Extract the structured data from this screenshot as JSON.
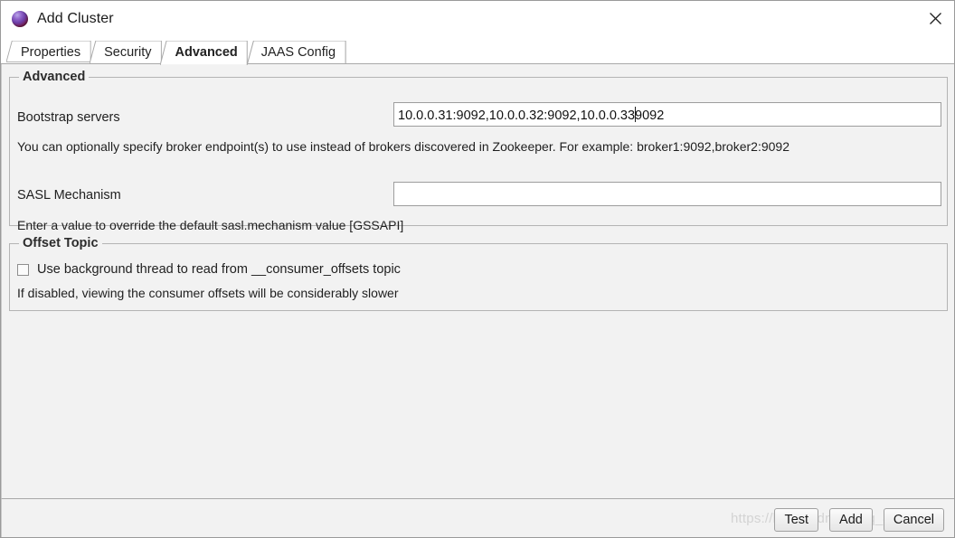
{
  "window": {
    "title": "Add Cluster",
    "icon": "cluster-sphere-icon",
    "close_label": "×"
  },
  "tabs": [
    {
      "label": "Properties",
      "selected": false
    },
    {
      "label": "Security",
      "selected": false
    },
    {
      "label": "Advanced",
      "selected": true
    },
    {
      "label": "JAAS Config",
      "selected": false
    }
  ],
  "advanced_group": {
    "title": "Advanced",
    "bootstrap": {
      "label": "Bootstrap servers",
      "value": "10.0.0.31:9092,10.0.0.32:9092,10.0.0.33:9092",
      "value_before_caret": "10.0.0.31:9092,10.0.0.32:9092,10.0.0.33",
      "value_after_caret": "9092",
      "placeholder": "",
      "help": "You can optionally specify broker endpoint(s) to use instead of brokers discovered in Zookeeper. For example: broker1:9092,broker2:9092"
    },
    "sasl": {
      "label": "SASL Mechanism",
      "value": "",
      "placeholder": "",
      "help": "Enter a value to override the default sasl.mechanism value [GSSAPI]"
    }
  },
  "offset_group": {
    "title": "Offset Topic",
    "checkbox_label": "Use background thread to read from __consumer_offsets topic",
    "checkbox_checked": false,
    "help": "If disabled, viewing the consumer offsets will be considerably slower"
  },
  "footer": {
    "watermark": "https://blog.csdn.net/qq_42",
    "buttons": [
      {
        "label": "Test"
      },
      {
        "label": "Add"
      },
      {
        "label": "Cancel"
      }
    ]
  },
  "colors": {
    "dialog_bg": "#f2f2f2",
    "titlebar_bg": "#ffffff",
    "border": "#b4b4b4",
    "text": "#1f1f1f",
    "input_bg": "#ffffff",
    "watermark": "#d3d3d3"
  }
}
